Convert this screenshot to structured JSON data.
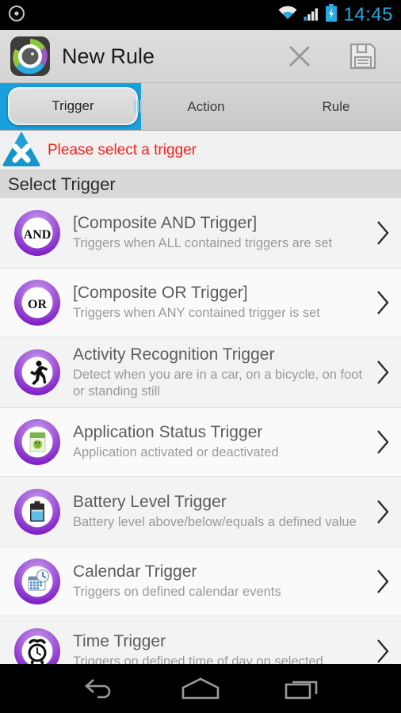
{
  "statusbar": {
    "time": "14:45",
    "left_icon": "record-circle-icon",
    "icons": [
      "wifi-icon",
      "signal-icon",
      "battery-charging-icon"
    ],
    "clock_color": "#2aa9e0"
  },
  "actionbar": {
    "title": "New Rule",
    "logo_name": "app-logo-icon",
    "cancel_label": "close-icon",
    "save_label": "save-icon"
  },
  "tabs": {
    "selected_index": 0,
    "accent_color": "#18a0dc",
    "items": [
      {
        "label": "Trigger"
      },
      {
        "label": "Action"
      },
      {
        "label": "Rule"
      }
    ]
  },
  "warning": {
    "text": "Please select a trigger",
    "color": "#f8201e",
    "icon": "warning-x-triangle-icon"
  },
  "section": {
    "title": "Select Trigger"
  },
  "list": {
    "items": [
      {
        "icon": "composite-and-icon",
        "title": "[Composite AND Trigger]",
        "subtitle": "Triggers when ALL contained triggers are set"
      },
      {
        "icon": "composite-or-icon",
        "title": "[Composite OR Trigger]",
        "subtitle": "Triggers when ANY contained trigger is set"
      },
      {
        "icon": "activity-recognition-icon",
        "title": "Activity Recognition Trigger",
        "subtitle": "Detect when you are in a car, on a bicycle, on foot or standing still"
      },
      {
        "icon": "application-status-icon",
        "title": "Application Status Trigger",
        "subtitle": "Application activated or deactivated"
      },
      {
        "icon": "battery-level-icon",
        "title": "Battery Level Trigger",
        "subtitle": "Battery level above/below/equals a defined value"
      },
      {
        "icon": "calendar-icon",
        "title": "Calendar Trigger",
        "subtitle": "Triggers on defined calendar events"
      },
      {
        "icon": "alarm-clock-icon",
        "title": "Time Trigger",
        "subtitle": "Triggers on defined time of day on selected"
      }
    ]
  },
  "navbar": {
    "back": "back-icon",
    "home": "home-icon",
    "recents": "recents-icon"
  }
}
